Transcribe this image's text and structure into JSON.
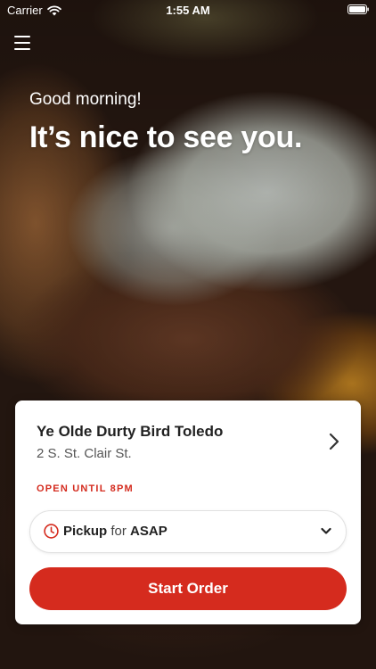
{
  "status_bar": {
    "carrier": "Carrier",
    "time": "1:55 AM"
  },
  "header": {
    "greeting": "Good morning!",
    "headline": "It’s nice to see you."
  },
  "location_card": {
    "name": "Ye Olde Durty Bird Toledo",
    "address": "2 S. St. Clair St.",
    "hours": "OPEN UNTIL 8PM",
    "pickup": {
      "mode": "Pickup",
      "connector": "for",
      "time": "ASAP"
    },
    "start_order_label": "Start Order"
  },
  "colors": {
    "accent": "#d52b1e",
    "text_dark": "#222222",
    "text_muted": "#555555"
  },
  "icons": [
    "wifi-icon",
    "battery-icon",
    "menu-icon",
    "chevron-right-icon",
    "clock-icon",
    "chevron-down-icon"
  ]
}
